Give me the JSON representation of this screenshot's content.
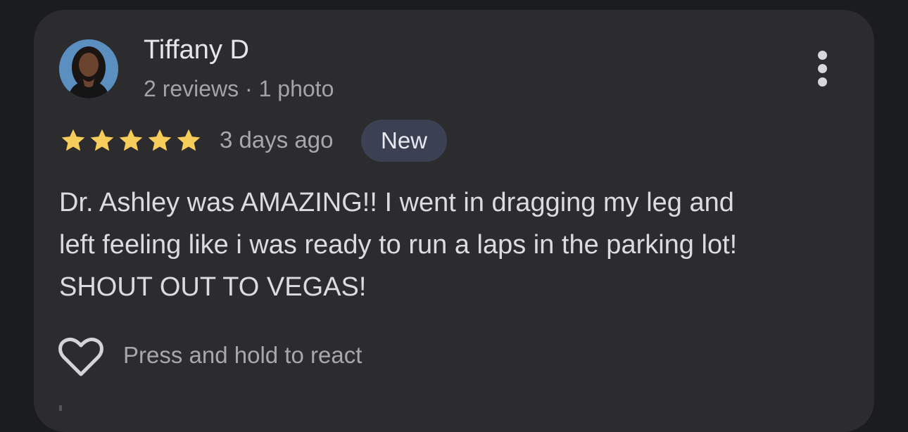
{
  "review": {
    "reviewer_name": "Tiffany D",
    "reviewer_meta": "2 reviews · 1 photo",
    "rating": 5,
    "rating_max": 5,
    "date": "3 days ago",
    "badge": "New",
    "text": "Dr. Ashley was AMAZING!! I went in dragging my leg and\nleft feeling like i was ready to run a laps in the parking lot!\nSHOUT OUT TO VEGAS!",
    "react_hint": "Press and hold to react"
  },
  "icons": {
    "more": "more-vert-icon",
    "star": "star-icon",
    "heart": "heart-outline-icon"
  },
  "colors": {
    "background": "#1b1c1e",
    "card": "#2c2c2e",
    "star": "#f6cc5a",
    "badge_bg": "#3b4052"
  }
}
